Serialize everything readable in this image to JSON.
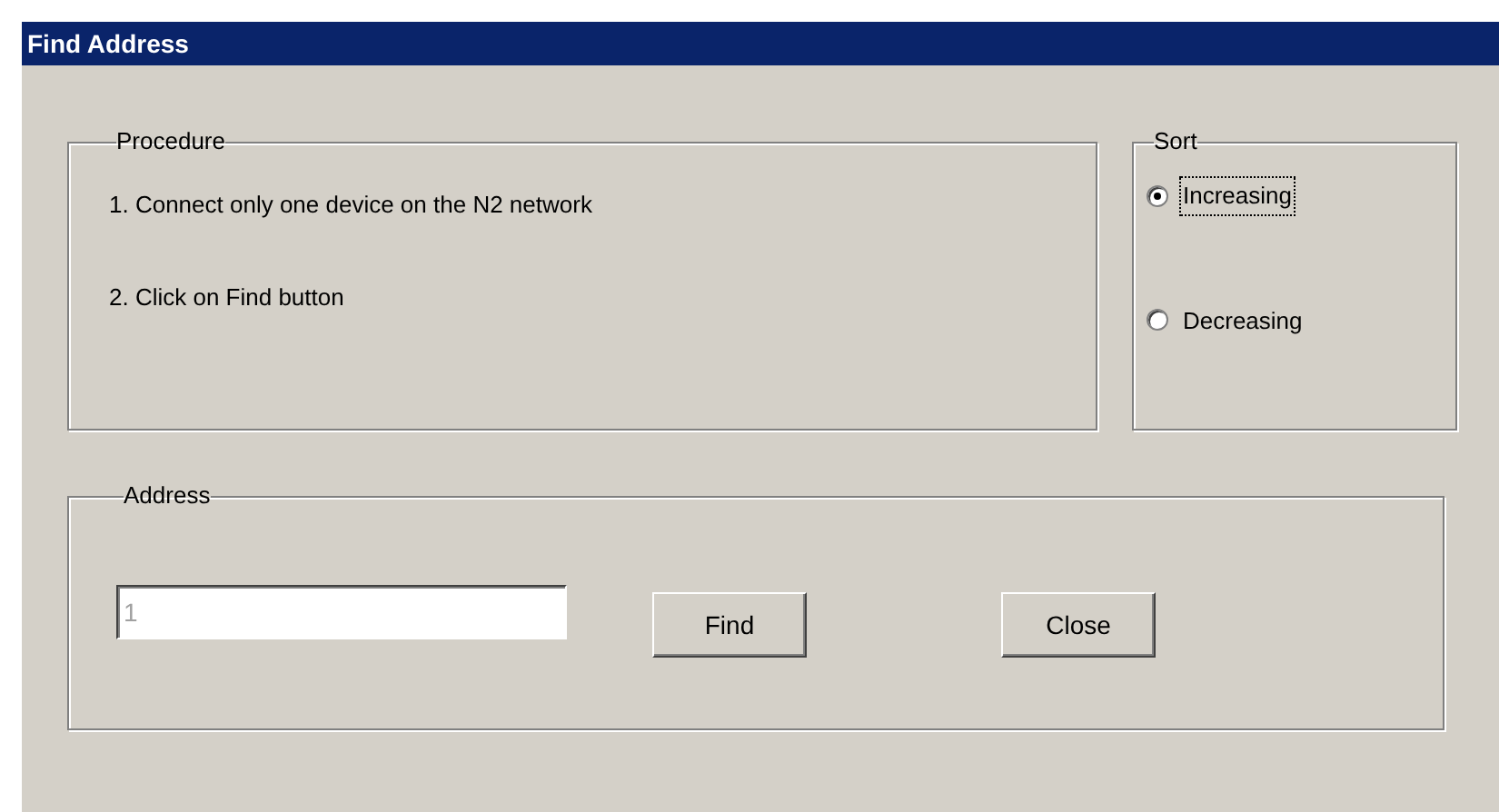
{
  "window": {
    "title": "Find Address"
  },
  "procedure": {
    "title": "Procedure",
    "steps": [
      "1. Connect only one device on the N2 network",
      "2. Click on Find button"
    ]
  },
  "sort": {
    "title": "Sort",
    "options": [
      {
        "label": "Increasing",
        "selected": true,
        "focused": true
      },
      {
        "label": "Decreasing",
        "selected": false,
        "focused": false
      }
    ]
  },
  "address": {
    "title": "Address",
    "field": {
      "value": "1",
      "disabled": true
    },
    "buttons": [
      "Find",
      "Close"
    ]
  }
}
